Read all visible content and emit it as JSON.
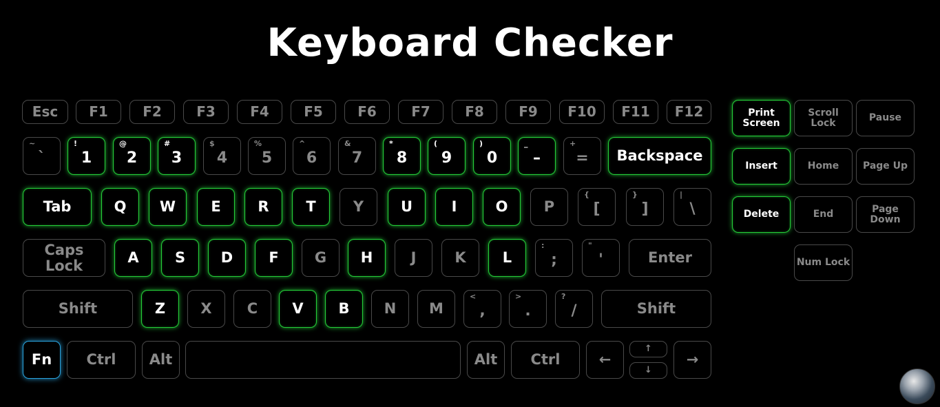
{
  "title": "Keyboard Checker",
  "colors": {
    "background": "#000000",
    "key_border": "#4a4a4a",
    "key_text": "#8a8a8a",
    "active_glow": "#25d03a",
    "fn_glow": "#2aa5e0",
    "active_text": "#ffffff"
  },
  "main_keys": [
    {
      "id": "esc",
      "label": "Esc",
      "state": "off",
      "kind": "fx"
    },
    {
      "id": "f1",
      "label": "F1",
      "state": "off",
      "kind": "fx"
    },
    {
      "id": "f2",
      "label": "F2",
      "state": "off",
      "kind": "fx"
    },
    {
      "id": "f3",
      "label": "F3",
      "state": "off",
      "kind": "fx"
    },
    {
      "id": "f4",
      "label": "F4",
      "state": "off",
      "kind": "fx"
    },
    {
      "id": "f5",
      "label": "F5",
      "state": "off",
      "kind": "fx"
    },
    {
      "id": "f6",
      "label": "F6",
      "state": "off",
      "kind": "fx"
    },
    {
      "id": "f7",
      "label": "F7",
      "state": "off",
      "kind": "fx"
    },
    {
      "id": "f8",
      "label": "F8",
      "state": "off",
      "kind": "fx"
    },
    {
      "id": "f9",
      "label": "F9",
      "state": "off",
      "kind": "fx"
    },
    {
      "id": "f10",
      "label": "F10",
      "state": "off",
      "kind": "fx"
    },
    {
      "id": "f11",
      "label": "F11",
      "state": "off",
      "kind": "fx"
    },
    {
      "id": "f12",
      "label": "F12",
      "state": "off",
      "kind": "fx"
    },
    {
      "id": "backquote",
      "label": "`",
      "shift": "~",
      "state": "off",
      "kind": "dual"
    },
    {
      "id": "digit1",
      "label": "1",
      "shift": "!",
      "state": "on",
      "kind": "dual"
    },
    {
      "id": "digit2",
      "label": "2",
      "shift": "@",
      "state": "on",
      "kind": "dual"
    },
    {
      "id": "digit3",
      "label": "3",
      "shift": "#",
      "state": "on",
      "kind": "dual"
    },
    {
      "id": "digit4",
      "label": "4",
      "shift": "$",
      "state": "off",
      "kind": "dual"
    },
    {
      "id": "digit5",
      "label": "5",
      "shift": "%",
      "state": "off",
      "kind": "dual"
    },
    {
      "id": "digit6",
      "label": "6",
      "shift": "^",
      "state": "off",
      "kind": "dual"
    },
    {
      "id": "digit7",
      "label": "7",
      "shift": "&",
      "state": "off",
      "kind": "dual"
    },
    {
      "id": "digit8",
      "label": "8",
      "shift": "*",
      "state": "on",
      "kind": "dual"
    },
    {
      "id": "digit9",
      "label": "9",
      "shift": "(",
      "state": "on",
      "kind": "dual"
    },
    {
      "id": "digit0",
      "label": "0",
      "shift": ")",
      "state": "on",
      "kind": "dual"
    },
    {
      "id": "minus",
      "label": "–",
      "shift": "_",
      "state": "on",
      "kind": "dual"
    },
    {
      "id": "equal",
      "label": "=",
      "shift": "+",
      "state": "off",
      "kind": "dual"
    },
    {
      "id": "backspace",
      "label": "Backspace",
      "state": "on",
      "kind": "word"
    },
    {
      "id": "tab",
      "label": "Tab",
      "state": "on",
      "kind": "word"
    },
    {
      "id": "q",
      "label": "Q",
      "state": "on",
      "kind": "letter"
    },
    {
      "id": "w",
      "label": "W",
      "state": "on",
      "kind": "letter"
    },
    {
      "id": "e",
      "label": "E",
      "state": "on",
      "kind": "letter"
    },
    {
      "id": "r",
      "label": "R",
      "state": "on",
      "kind": "letter"
    },
    {
      "id": "t",
      "label": "T",
      "state": "on",
      "kind": "letter"
    },
    {
      "id": "y",
      "label": "Y",
      "state": "off",
      "kind": "letter"
    },
    {
      "id": "u",
      "label": "U",
      "state": "on",
      "kind": "letter"
    },
    {
      "id": "i",
      "label": "I",
      "state": "on",
      "kind": "letter"
    },
    {
      "id": "o",
      "label": "O",
      "state": "on",
      "kind": "letter"
    },
    {
      "id": "p",
      "label": "P",
      "state": "off",
      "kind": "letter"
    },
    {
      "id": "bracketleft",
      "label": "[",
      "shift": "{",
      "state": "off",
      "kind": "dual"
    },
    {
      "id": "bracketright",
      "label": "]",
      "shift": "}",
      "state": "off",
      "kind": "dual"
    },
    {
      "id": "backslash",
      "label": "\\",
      "shift": "|",
      "state": "off",
      "kind": "dual"
    },
    {
      "id": "capslock",
      "label": "Caps Lock",
      "state": "off",
      "kind": "word"
    },
    {
      "id": "a",
      "label": "A",
      "state": "on",
      "kind": "letter"
    },
    {
      "id": "s",
      "label": "S",
      "state": "on",
      "kind": "letter"
    },
    {
      "id": "d",
      "label": "D",
      "state": "on",
      "kind": "letter"
    },
    {
      "id": "f",
      "label": "F",
      "state": "on",
      "kind": "letter"
    },
    {
      "id": "g",
      "label": "G",
      "state": "off",
      "kind": "letter"
    },
    {
      "id": "h",
      "label": "H",
      "state": "on",
      "kind": "letter"
    },
    {
      "id": "j",
      "label": "J",
      "state": "off",
      "kind": "letter"
    },
    {
      "id": "k",
      "label": "K",
      "state": "off",
      "kind": "letter"
    },
    {
      "id": "l",
      "label": "L",
      "state": "on",
      "kind": "letter"
    },
    {
      "id": "semicolon",
      "label": ";",
      "shift": ":",
      "state": "off",
      "kind": "dual"
    },
    {
      "id": "quote",
      "label": "'",
      "shift": "\"",
      "state": "off",
      "kind": "dual"
    },
    {
      "id": "enter",
      "label": "Enter",
      "state": "off",
      "kind": "word"
    },
    {
      "id": "shift-left",
      "label": "Shift",
      "state": "off",
      "kind": "word"
    },
    {
      "id": "z",
      "label": "Z",
      "state": "on",
      "kind": "letter"
    },
    {
      "id": "x",
      "label": "X",
      "state": "off",
      "kind": "letter"
    },
    {
      "id": "c",
      "label": "C",
      "state": "off",
      "kind": "letter"
    },
    {
      "id": "v",
      "label": "V",
      "state": "on",
      "kind": "letter"
    },
    {
      "id": "b",
      "label": "B",
      "state": "on",
      "kind": "letter"
    },
    {
      "id": "n",
      "label": "N",
      "state": "off",
      "kind": "letter"
    },
    {
      "id": "m",
      "label": "M",
      "state": "off",
      "kind": "letter"
    },
    {
      "id": "comma",
      "label": ",",
      "shift": "<",
      "state": "off",
      "kind": "dual"
    },
    {
      "id": "period",
      "label": ".",
      "shift": ">",
      "state": "off",
      "kind": "dual"
    },
    {
      "id": "slash",
      "label": "/",
      "shift": "?",
      "state": "off",
      "kind": "dual"
    },
    {
      "id": "shift-right",
      "label": "Shift",
      "state": "off",
      "kind": "word"
    },
    {
      "id": "fn",
      "label": "Fn",
      "state": "fn",
      "kind": "word"
    },
    {
      "id": "ctrl-left",
      "label": "Ctrl",
      "state": "off",
      "kind": "word"
    },
    {
      "id": "alt-left",
      "label": "Alt",
      "state": "off",
      "kind": "word"
    },
    {
      "id": "space",
      "label": "",
      "state": "off",
      "kind": "word"
    },
    {
      "id": "alt-right",
      "label": "Alt",
      "state": "off",
      "kind": "word"
    },
    {
      "id": "ctrl-right",
      "label": "Ctrl",
      "state": "off",
      "kind": "word"
    },
    {
      "id": "arrow-left",
      "label": "←",
      "state": "off",
      "kind": "word"
    },
    {
      "id": "arrow-up",
      "label": "↑",
      "state": "off",
      "kind": "tiny"
    },
    {
      "id": "arrow-down",
      "label": "↓",
      "state": "off",
      "kind": "tiny"
    },
    {
      "id": "arrow-right",
      "label": "→",
      "state": "off",
      "kind": "word"
    }
  ],
  "nav_keys": [
    {
      "id": "printscreen",
      "label": "Print\nScreen",
      "state": "on",
      "kind": "small"
    },
    {
      "id": "scrolllock",
      "label": "Scroll\nLock",
      "state": "off",
      "kind": "small"
    },
    {
      "id": "pause",
      "label": "Pause",
      "state": "off",
      "kind": "small"
    },
    {
      "id": "insert",
      "label": "Insert",
      "state": "on",
      "kind": "small"
    },
    {
      "id": "home",
      "label": "Home",
      "state": "off",
      "kind": "small"
    },
    {
      "id": "pageup",
      "label": "Page Up",
      "state": "off",
      "kind": "small"
    },
    {
      "id": "delete",
      "label": "Delete",
      "state": "on",
      "kind": "small"
    },
    {
      "id": "end",
      "label": "End",
      "state": "off",
      "kind": "small"
    },
    {
      "id": "pagedown",
      "label": "Page\nDown",
      "state": "off",
      "kind": "small"
    },
    {
      "id": "numlock",
      "label": "Num Lock",
      "state": "off",
      "kind": "small"
    }
  ]
}
